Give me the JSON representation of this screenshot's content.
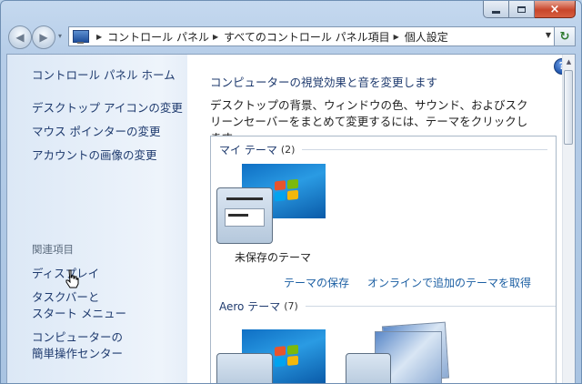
{
  "window": {
    "caption": {
      "minimize": "",
      "maximize": "",
      "close": "×"
    }
  },
  "navigation": {
    "back_glyph": "◀",
    "forward_glyph": "▶",
    "recent_glyph": "▾",
    "breadcrumbs": [
      "コントロール パネル",
      "すべてのコントロール パネル項目",
      "個人設定"
    ],
    "breadcrumb_sep": "▶",
    "dropdown_glyph": "▼",
    "refresh_glyph": "↻"
  },
  "sidebar": {
    "home": "コントロール パネル ホーム",
    "tasks": [
      "デスクトップ アイコンの変更",
      "マウス ポインターの変更",
      "アカウントの画像の変更"
    ],
    "related_title": "関連項目",
    "related": [
      {
        "label": "ディスプレイ"
      },
      {
        "line1": "タスクバーと",
        "line2": "スタート メニュー"
      },
      {
        "line1": "コンピューターの",
        "line2": "簡単操作センター"
      }
    ]
  },
  "main": {
    "help_glyph": "?",
    "title": "コンピューターの視覚効果と音を変更します",
    "description": "デスクトップの背景、ウィンドウの色、サウンド、およびスクリーンセーバーをまとめて変更するには、テーマをクリックします。",
    "my_themes": {
      "label": "マイ テーマ",
      "count": "(2)"
    },
    "unsaved_theme": "未保存のテーマ",
    "save_theme": "テーマの保存",
    "get_more": "オンラインで追加のテーマを取得",
    "aero_themes": {
      "label": "Aero テーマ",
      "count": "(7)"
    }
  },
  "colors": {
    "link": "#1e3a6e",
    "hyperlink": "#1c5fa3",
    "close_button": "#c8462b"
  }
}
